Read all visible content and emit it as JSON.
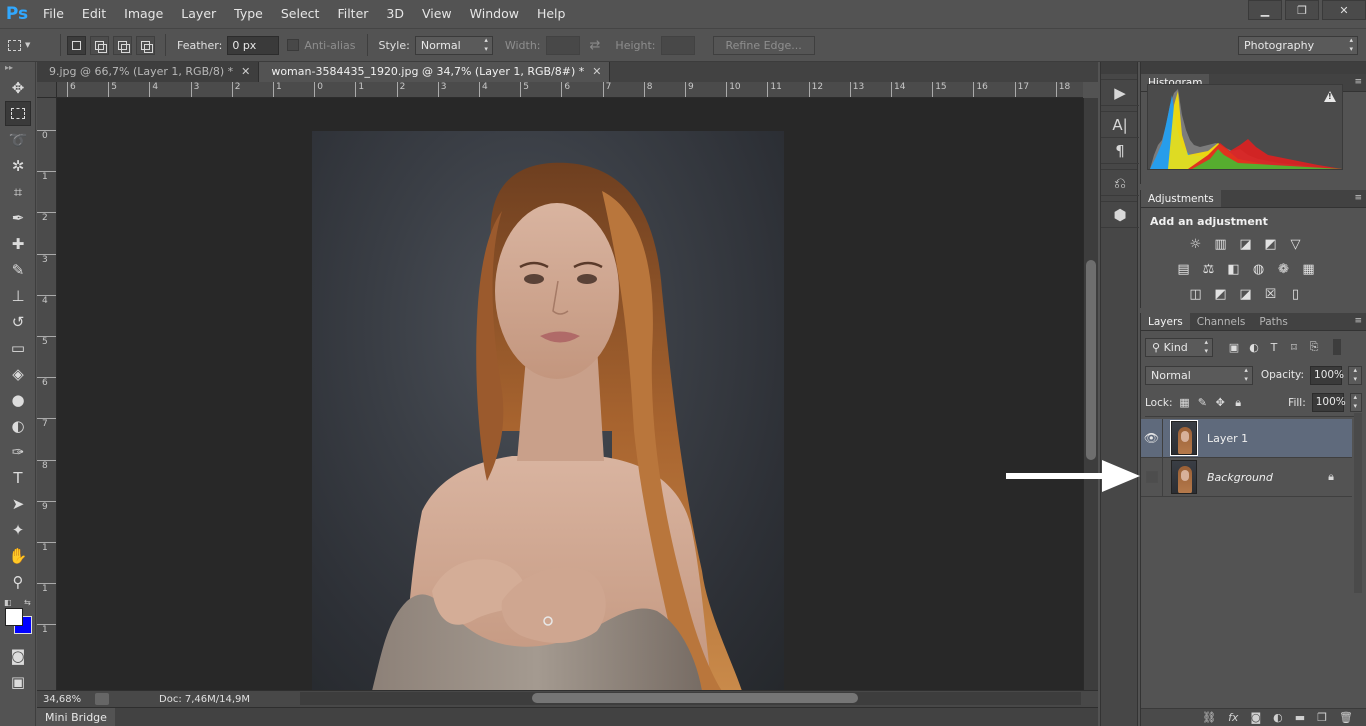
{
  "app": {
    "logo": "Ps"
  },
  "menu": [
    "File",
    "Edit",
    "Image",
    "Layer",
    "Type",
    "Select",
    "Filter",
    "3D",
    "View",
    "Window",
    "Help"
  ],
  "window_buttons": {
    "minimize": "▁",
    "restore": "❐",
    "close": "✕"
  },
  "options": {
    "feather_label": "Feather:",
    "feather_value": "0 px",
    "antialias_label": "Anti-alias",
    "style_label": "Style:",
    "style_value": "Normal",
    "width_label": "Width:",
    "height_label": "Height:",
    "refine_edge": "Refine Edge...",
    "workspace": "Photography"
  },
  "tabs": [
    {
      "label": "9.jpg @ 66,7% (Layer 1, RGB/8) *",
      "active": false
    },
    {
      "label": "woman-3584435_1920.jpg @ 34,7% (Layer 1, RGB/8#) *",
      "active": true
    }
  ],
  "ruler_top": [
    "6",
    "5",
    "4",
    "3",
    "2",
    "1",
    "0",
    "1",
    "2",
    "3",
    "4",
    "5",
    "6",
    "7",
    "8",
    "9",
    "10",
    "11",
    "12",
    "13",
    "14",
    "15",
    "16",
    "17",
    "18"
  ],
  "ruler_left": [
    "0",
    "1",
    "2",
    "3",
    "4",
    "5",
    "6",
    "7",
    "8",
    "9",
    "1",
    "1",
    "1"
  ],
  "status": {
    "zoom": "34,68%",
    "doc": "Doc: 7,46M/14,9M"
  },
  "mini_bridge": "Mini Bridge",
  "tools": [
    "move-icon",
    "marquee-icon",
    "lasso-icon",
    "magic-wand-icon",
    "crop-icon",
    "eyedropper-icon",
    "healing-icon",
    "brush-icon",
    "stamp-icon",
    "history-brush-icon",
    "eraser-icon",
    "bucket-icon",
    "blur-icon",
    "dodge-icon",
    "pen-icon",
    "type-icon",
    "path-select-icon",
    "shape-icon",
    "hand-icon",
    "zoom-icon"
  ],
  "colors": {
    "foreground": "#ffffff",
    "background": "#0000ff",
    "selected_layer": "#5f6a7c"
  },
  "histogram": {
    "tab": "Histogram"
  },
  "adjustments": {
    "tab": "Adjustments",
    "title": "Add an adjustment"
  },
  "layers_panel": {
    "tabs": [
      "Layers",
      "Channels",
      "Paths"
    ],
    "kind": "Kind",
    "blend_mode": "Normal",
    "opacity_label": "Opacity:",
    "opacity_value": "100%",
    "lock_label": "Lock:",
    "fill_label": "Fill:",
    "fill_value": "100%",
    "layers": [
      {
        "name": "Layer 1",
        "visible": true,
        "selected": true
      },
      {
        "name": "Background",
        "visible": false,
        "selected": false,
        "locked": true
      }
    ]
  }
}
